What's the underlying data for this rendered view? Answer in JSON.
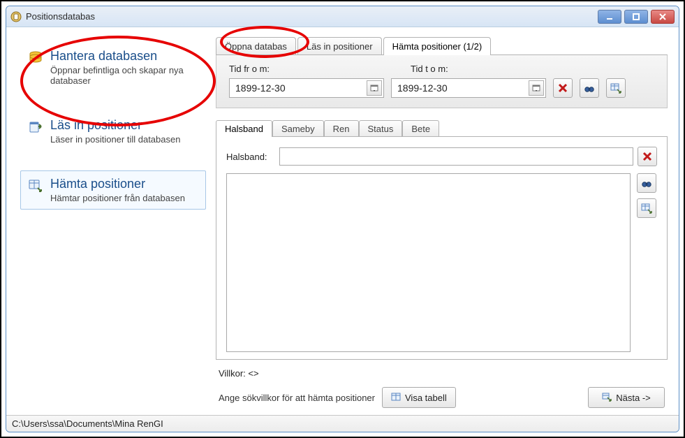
{
  "window": {
    "title": "Positionsdatabas"
  },
  "sidebar": {
    "items": [
      {
        "title": "Hantera databasen",
        "desc": "Öppnar befintliga och skapar nya databaser"
      },
      {
        "title": "Läs in positioner",
        "desc": "Läser in positioner till databasen"
      },
      {
        "title": "Hämta positioner",
        "desc": "Hämtar positioner från databasen"
      }
    ]
  },
  "top_tabs": {
    "t0": "Öppna databas",
    "t1": "Läs in positioner",
    "t2": "Hämta positioner (1/2)"
  },
  "date": {
    "from_label": "Tid fr o m:",
    "to_label": "Tid t o m:",
    "from_value": "1899-12-30",
    "to_value": "1899-12-30"
  },
  "sub_tabs": {
    "t0": "Halsband",
    "t1": "Sameby",
    "t2": "Ren",
    "t3": "Status",
    "t4": "Bete"
  },
  "halsband": {
    "label": "Halsband:",
    "value": ""
  },
  "villkor": "Villkor:  <>",
  "footer": {
    "hint": "Ange sökvillkor för att hämta positioner",
    "show_table": "Visa tabell",
    "next": "Nästa ->"
  },
  "statusbar": {
    "path": "C:\\Users\\ssa\\Documents\\Mina RenGI"
  }
}
